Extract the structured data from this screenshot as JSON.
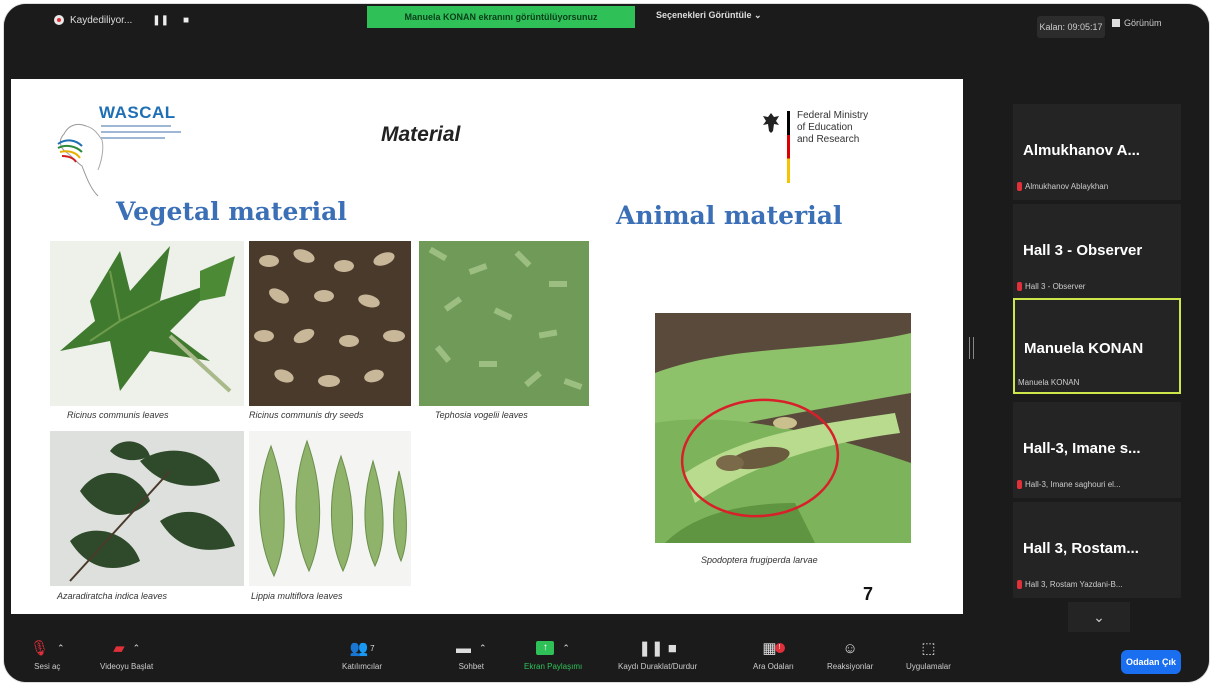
{
  "topbar": {
    "recording_label": "Kaydediliyor...",
    "share_banner": "Manuela KONAN ekranını görüntülüyorsunuz",
    "view_options": "Seçenekleri Görüntüle ⌄",
    "timer": "Kalan: 09:05:17",
    "view_button": "Görünüm"
  },
  "slide": {
    "logo_text": "WASCAL",
    "title": "Material",
    "ministry_text": "Federal Ministry\nof Education\nand Research",
    "vegetal_heading": "Vegetal material",
    "animal_heading": "Animal  material",
    "captions": [
      "Ricinus communis leaves",
      "Ricinus communis dry seeds",
      "Tephosia vogelii leaves",
      "Azaradiratcha indica leaves",
      "Lippia multiflora leaves",
      "Spodoptera frugiperda larvae"
    ],
    "slide_number": "7"
  },
  "participants": [
    {
      "name": "Almukhanov  A...",
      "label": "Almukhanov Ablaykhan",
      "muted": true
    },
    {
      "name": "Hall 3 - Observer",
      "label": "Hall 3 - Observer",
      "muted": true
    },
    {
      "name": "Manuela KONAN",
      "label": "Manuela KONAN",
      "muted": false,
      "active_speaker": true
    },
    {
      "name": "Hall-3, Imane s...",
      "label": "Hall-3, Imane saghouri el...",
      "muted": true
    },
    {
      "name": "Hall 3, Rostam...",
      "label": "Hall 3, Rostam Yazdani-B...",
      "muted": true
    }
  ],
  "toolbar": {
    "mute": "Sesi aç",
    "video": "Videoyu Başlat",
    "participants": "Katılımcılar",
    "participants_count": "7",
    "chat": "Sohbet",
    "share": "Ekran Paylaşımı",
    "record": "Kaydı Duraklat/Durdur",
    "breakout": "Ara Odaları",
    "breakout_badge": "!",
    "reactions": "Reaksiyonlar",
    "apps": "Uygulamalar",
    "leave": "Odadan Çık"
  },
  "colors": {
    "share_banner": "#2fc158",
    "leave_button": "#1a6ef0",
    "active_speaker_border": "#cde64a",
    "heading_blue": "#3b6fb6"
  }
}
